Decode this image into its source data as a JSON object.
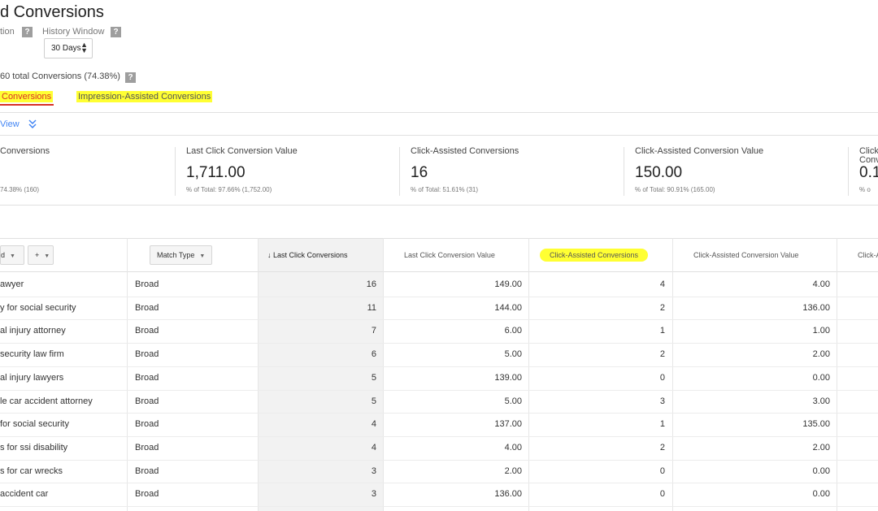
{
  "header": {
    "title": "d Conversions",
    "attribution_label": "tion",
    "history_label": "History Window",
    "history_value": "30 Days",
    "help_glyph": "?"
  },
  "summary": {
    "text": "60 total Conversions (74.38%)"
  },
  "tabs": [
    {
      "label": "Conversions"
    },
    {
      "label": "Impression-Assisted Conversions"
    }
  ],
  "view_link": {
    "label": "View"
  },
  "cards": [
    {
      "label": "Conversions",
      "value": "",
      "sub": "74.38% (160)"
    },
    {
      "label": "Last Click Conversion Value",
      "value": "1,711.00",
      "sub": "% of Total: 97.66% (1,752.00)"
    },
    {
      "label": "Click-Assisted Conversions",
      "value": "16",
      "sub": "% of Total: 51.61% (31)"
    },
    {
      "label": "Click-Assisted Conversion Value",
      "value": "150.00",
      "sub": "% of Total: 90.91% (165.00)"
    },
    {
      "label": "Click",
      "label2": "Conv",
      "value": "0.1",
      "sub": "% o"
    }
  ],
  "table": {
    "dim_button": "d",
    "add_button": "+",
    "match_type_button": "Match Type",
    "sort_arrow": "↓",
    "headers": {
      "last_click": "Last Click Conversions",
      "last_click_value": "Last Click Conversion Value",
      "click_assisted": "Click-Assisted Conversions",
      "click_assisted_value": "Click-Assisted Conversion Value",
      "next": "Click-A"
    },
    "rows": [
      {
        "keyword": "awyer",
        "match": "Broad",
        "lc": "16",
        "lcv": "149.00",
        "ca": "4",
        "cav": "4.00"
      },
      {
        "keyword": "y for social security",
        "match": "Broad",
        "lc": "11",
        "lcv": "144.00",
        "ca": "2",
        "cav": "136.00"
      },
      {
        "keyword": "al injury attorney",
        "match": "Broad",
        "lc": "7",
        "lcv": "6.00",
        "ca": "1",
        "cav": "1.00"
      },
      {
        "keyword": "security law firm",
        "match": "Broad",
        "lc": "6",
        "lcv": "5.00",
        "ca": "2",
        "cav": "2.00"
      },
      {
        "keyword": "al injury lawyers",
        "match": "Broad",
        "lc": "5",
        "lcv": "139.00",
        "ca": "0",
        "cav": "0.00"
      },
      {
        "keyword": "le car accident attorney",
        "match": "Broad",
        "lc": "5",
        "lcv": "5.00",
        "ca": "3",
        "cav": "3.00"
      },
      {
        "keyword": "for social security",
        "match": "Broad",
        "lc": "4",
        "lcv": "137.00",
        "ca": "1",
        "cav": "135.00"
      },
      {
        "keyword": "s for ssi disability",
        "match": "Broad",
        "lc": "4",
        "lcv": "4.00",
        "ca": "2",
        "cav": "2.00"
      },
      {
        "keyword": "s for car wrecks",
        "match": "Broad",
        "lc": "3",
        "lcv": "2.00",
        "ca": "0",
        "cav": "0.00"
      },
      {
        "keyword": "accident car",
        "match": "Broad",
        "lc": "3",
        "lcv": "136.00",
        "ca": "0",
        "cav": "0.00"
      }
    ]
  },
  "colors": {
    "accent_red": "#d93025",
    "link_blue": "#4285f4",
    "highlight": "#ffff33"
  }
}
